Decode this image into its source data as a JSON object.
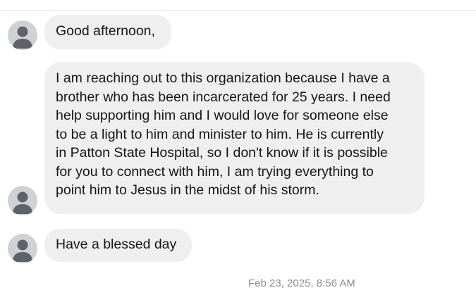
{
  "messages": [
    {
      "lines": [
        "Good afternoon,"
      ]
    },
    {
      "lines": [
        "I am reaching out to this organization because I have a",
        "brother who has been incarcerated for 25 years. I need",
        "help supporting him and I would love for someone else",
        "to be a light to him and minister to him. He is currently",
        "in Patton State Hospital, so I don't know if it is possible",
        "for you to connect with him, I am trying everything to",
        "point him to Jesus in the midst of his storm."
      ]
    },
    {
      "lines": [
        "Have a blessed day"
      ]
    }
  ],
  "timestamp": "Feb 23, 2025, 8:56 AM",
  "icons": {
    "avatar": "default-user-avatar-icon"
  },
  "colors": {
    "bubble_background": "#efefef",
    "avatar_background": "#cfd1d4",
    "avatar_figure": "#5f6368",
    "timestamp_text": "#8d8d8d"
  }
}
